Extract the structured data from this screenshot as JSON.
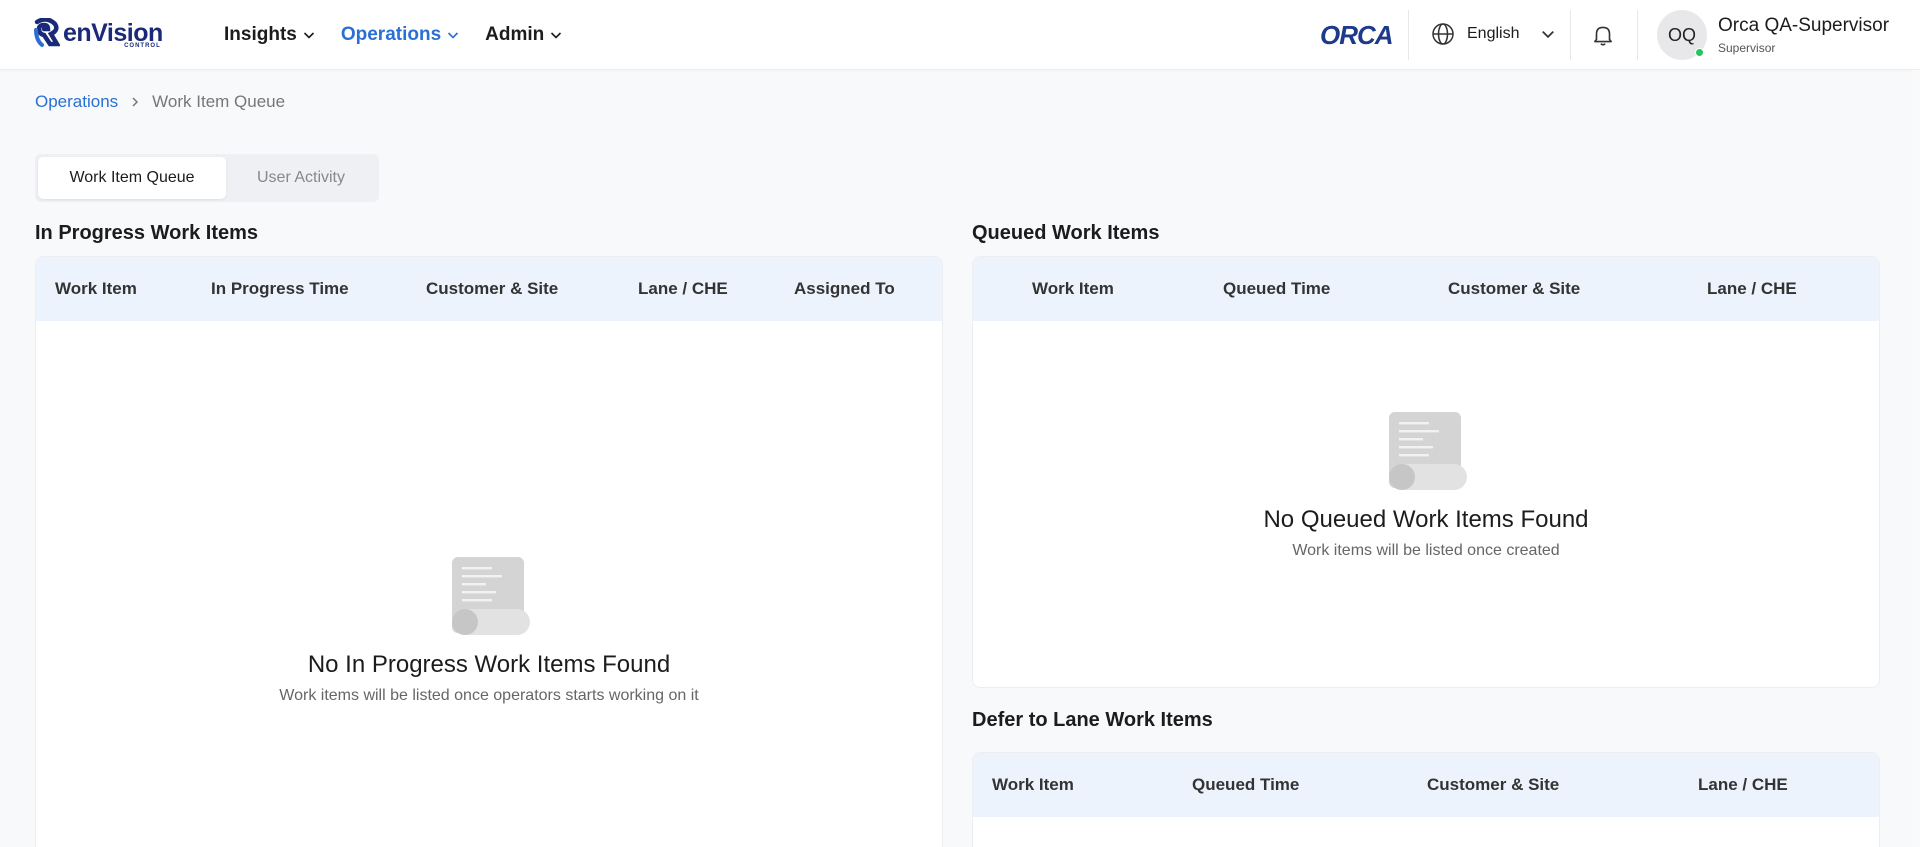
{
  "header": {
    "brand": {
      "name": "enVision",
      "sub": "CONTROL"
    },
    "nav": [
      {
        "label": "Insights",
        "active": false
      },
      {
        "label": "Operations",
        "active": true
      },
      {
        "label": "Admin",
        "active": false
      }
    ],
    "partner_logo": "ORCA",
    "language": "English",
    "user": {
      "initials": "OQ",
      "name": "Orca QA-Supervisor",
      "role": "Supervisor",
      "status": "online"
    }
  },
  "breadcrumb": {
    "parent": "Operations",
    "current": "Work Item Queue"
  },
  "tabs": [
    {
      "label": "Work Item Queue",
      "active": true
    },
    {
      "label": "User Activity",
      "active": false
    }
  ],
  "in_progress": {
    "title": "In Progress Work Items",
    "columns": [
      "Work Item",
      "In Progress Time",
      "Customer & Site",
      "Lane / CHE",
      "Assigned To"
    ],
    "rows": [],
    "empty_title": "No In Progress Work Items Found",
    "empty_subtitle": "Work items will be listed once operators starts working on it"
  },
  "queued": {
    "title": "Queued Work Items",
    "columns": [
      "Work Item",
      "Queued Time",
      "Customer & Site",
      "Lane / CHE"
    ],
    "rows": [],
    "empty_title": "No Queued Work Items Found",
    "empty_subtitle": "Work items will be listed once created"
  },
  "defer": {
    "title": "Defer to Lane Work Items",
    "columns": [
      "Work Item",
      "Queued Time",
      "Customer & Site",
      "Lane / CHE"
    ],
    "rows": []
  },
  "colors": {
    "accent": "#2a6fd6",
    "table_header_bg": "#edf3fd",
    "brand": "#1a2a78",
    "online": "#22c55e"
  },
  "icons": [
    "globe-icon",
    "chevron-down-icon",
    "bell-icon",
    "chevron-right-icon",
    "empty-document-icon"
  ]
}
